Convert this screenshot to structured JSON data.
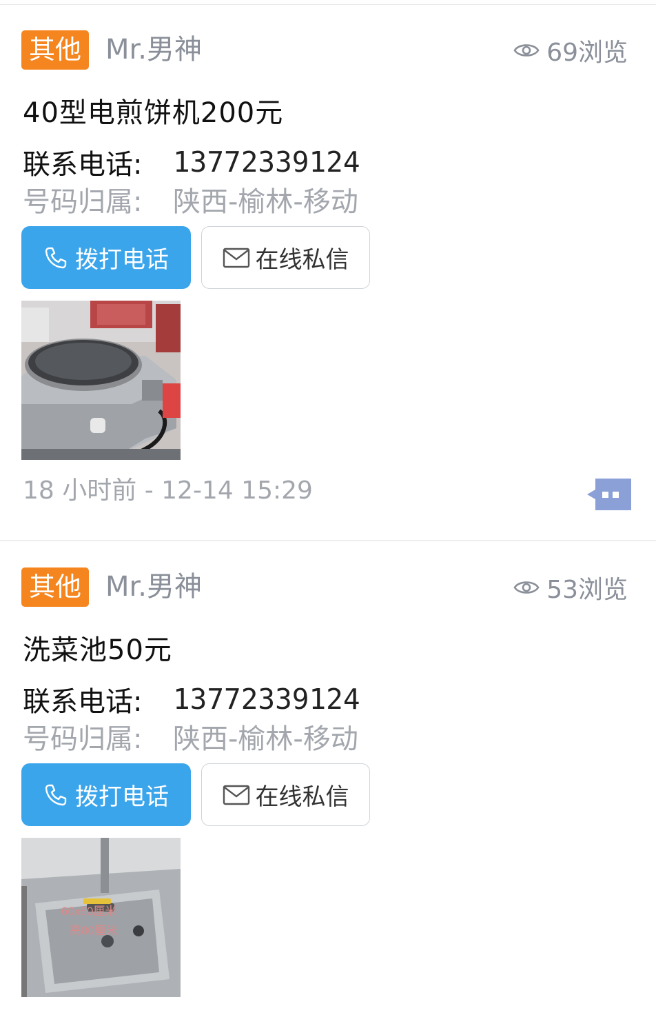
{
  "posts": [
    {
      "category": "其他",
      "user": "Mr.男神",
      "views": "69浏览",
      "title": "40型电煎饼机200元",
      "phone_label": "联系电话:",
      "phone": "13772339124",
      "location_label": "号码归属:",
      "location": "陕西-榆林-移动",
      "call_button": "拨打电话",
      "message_button": "在线私信",
      "photo_icon": "crepe-maker-photo",
      "time": "18 小时前 - 12-14 15:29",
      "comment_icon": "comment-icon"
    },
    {
      "category": "其他",
      "user": "Mr.男神",
      "views": "53浏览",
      "title": "洗菜池50元",
      "phone_label": "联系电话:",
      "phone": "13772339124",
      "location_label": "号码归属:",
      "location": "陕西-榆林-移动",
      "call_button": "拨打电话",
      "message_button": "在线私信",
      "photo_icon": "sink-photo",
      "photo_overlay": [
        "60x60厘米",
        "高80厘米"
      ]
    }
  ],
  "colors": {
    "tag_bg": "#f5861f",
    "call_button_bg": "#3ba5eb",
    "muted_text": "#a3a7ad",
    "comment_icon": "#8aa0d6"
  }
}
